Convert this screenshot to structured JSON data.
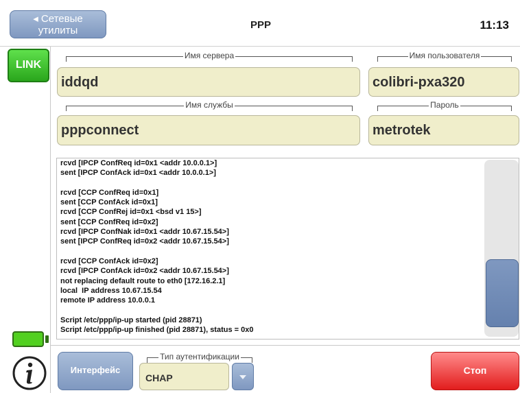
{
  "header": {
    "back_label_line1": "◂ Сетевые",
    "back_label_line2": "утилиты",
    "title": "PPP",
    "time": "11:13"
  },
  "sidebar": {
    "link_label": "LINK",
    "battery_icon": "battery-icon",
    "info_icon": "info-icon",
    "colors": {
      "link": "#3cc52a",
      "battery": "#52d020"
    }
  },
  "fields": {
    "server_name": {
      "label": "Имя сервера",
      "value": "iddqd"
    },
    "user_name": {
      "label": "Имя пользователя",
      "value": "colibri-pxa320"
    },
    "service_name": {
      "label": "Имя службы",
      "value": "pppconnect"
    },
    "password": {
      "label": "Пароль",
      "value": "metrotek"
    }
  },
  "log": {
    "lines": [
      "rcvd [IPCP ConfReq id=0x1 <addr 10.0.0.1>]",
      "sent [IPCP ConfAck id=0x1 <addr 10.0.0.1>]",
      "",
      "rcvd [CCP ConfReq id=0x1]",
      "sent [CCP ConfAck id=0x1]",
      "rcvd [CCP ConfRej id=0x1 <bsd v1 15>]",
      "sent [CCP ConfReq id=0x2]",
      "rcvd [IPCP ConfNak id=0x1 <addr 10.67.15.54>]",
      "sent [IPCP ConfReq id=0x2 <addr 10.67.15.54>]",
      "",
      "rcvd [CCP ConfAck id=0x2]",
      "rcvd [IPCP ConfAck id=0x2 <addr 10.67.15.54>]",
      "not replacing default route to eth0 [172.16.2.1]",
      "local  IP address 10.67.15.54",
      "remote IP address 10.0.0.1",
      "",
      "Script /etc/ppp/ip-up started (pid 28871)",
      "Script /etc/ppp/ip-up finished (pid 28871), status = 0x0"
    ]
  },
  "bottom": {
    "interface_label": "Интерфейс",
    "auth_label": "Тип аутентификации",
    "auth_value": "CHAP",
    "dropdown_icon": "chevron-down-icon",
    "stop_label": "Стоп",
    "colors": {
      "stop": "#e83030",
      "accent": "#7f98c0"
    }
  }
}
